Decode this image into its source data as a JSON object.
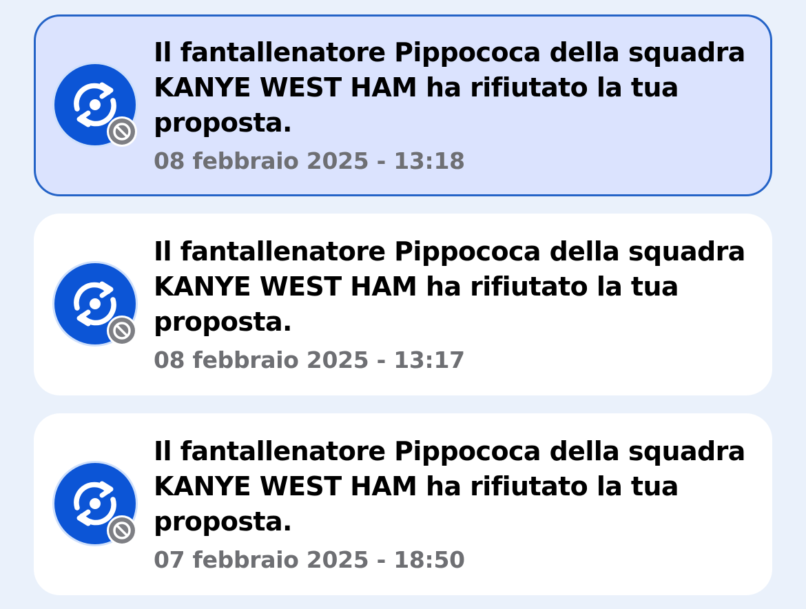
{
  "notifications": [
    {
      "message": "Il fantallenatore Pippococa della squadra KANYE WEST HAM ha rifiutato la tua proposta.",
      "timestamp": "08 febbraio 2025 - 13:18",
      "unread": true,
      "icon": "swap-icon",
      "badge_icon": "blocked-icon"
    },
    {
      "message": "Il fantallenatore Pippococa della squadra KANYE WEST HAM ha rifiutato la tua proposta.",
      "timestamp": "08 febbraio 2025 - 13:17",
      "unread": false,
      "icon": "swap-icon",
      "badge_icon": "blocked-icon"
    },
    {
      "message": "Il fantallenatore Pippococa della squadra KANYE WEST HAM ha rifiutato la tua proposta.",
      "timestamp": "07 febbraio 2025 - 18:50",
      "unread": false,
      "icon": "swap-icon",
      "badge_icon": "blocked-icon"
    }
  ],
  "colors": {
    "background": "#eaf1fb",
    "card": "#ffffff",
    "unread_card": "#dbe3fe",
    "unread_border": "#2463c7",
    "icon_blue": "#0c55d6",
    "badge_gray": "#7e7f84",
    "timestamp": "#6e6f73"
  }
}
